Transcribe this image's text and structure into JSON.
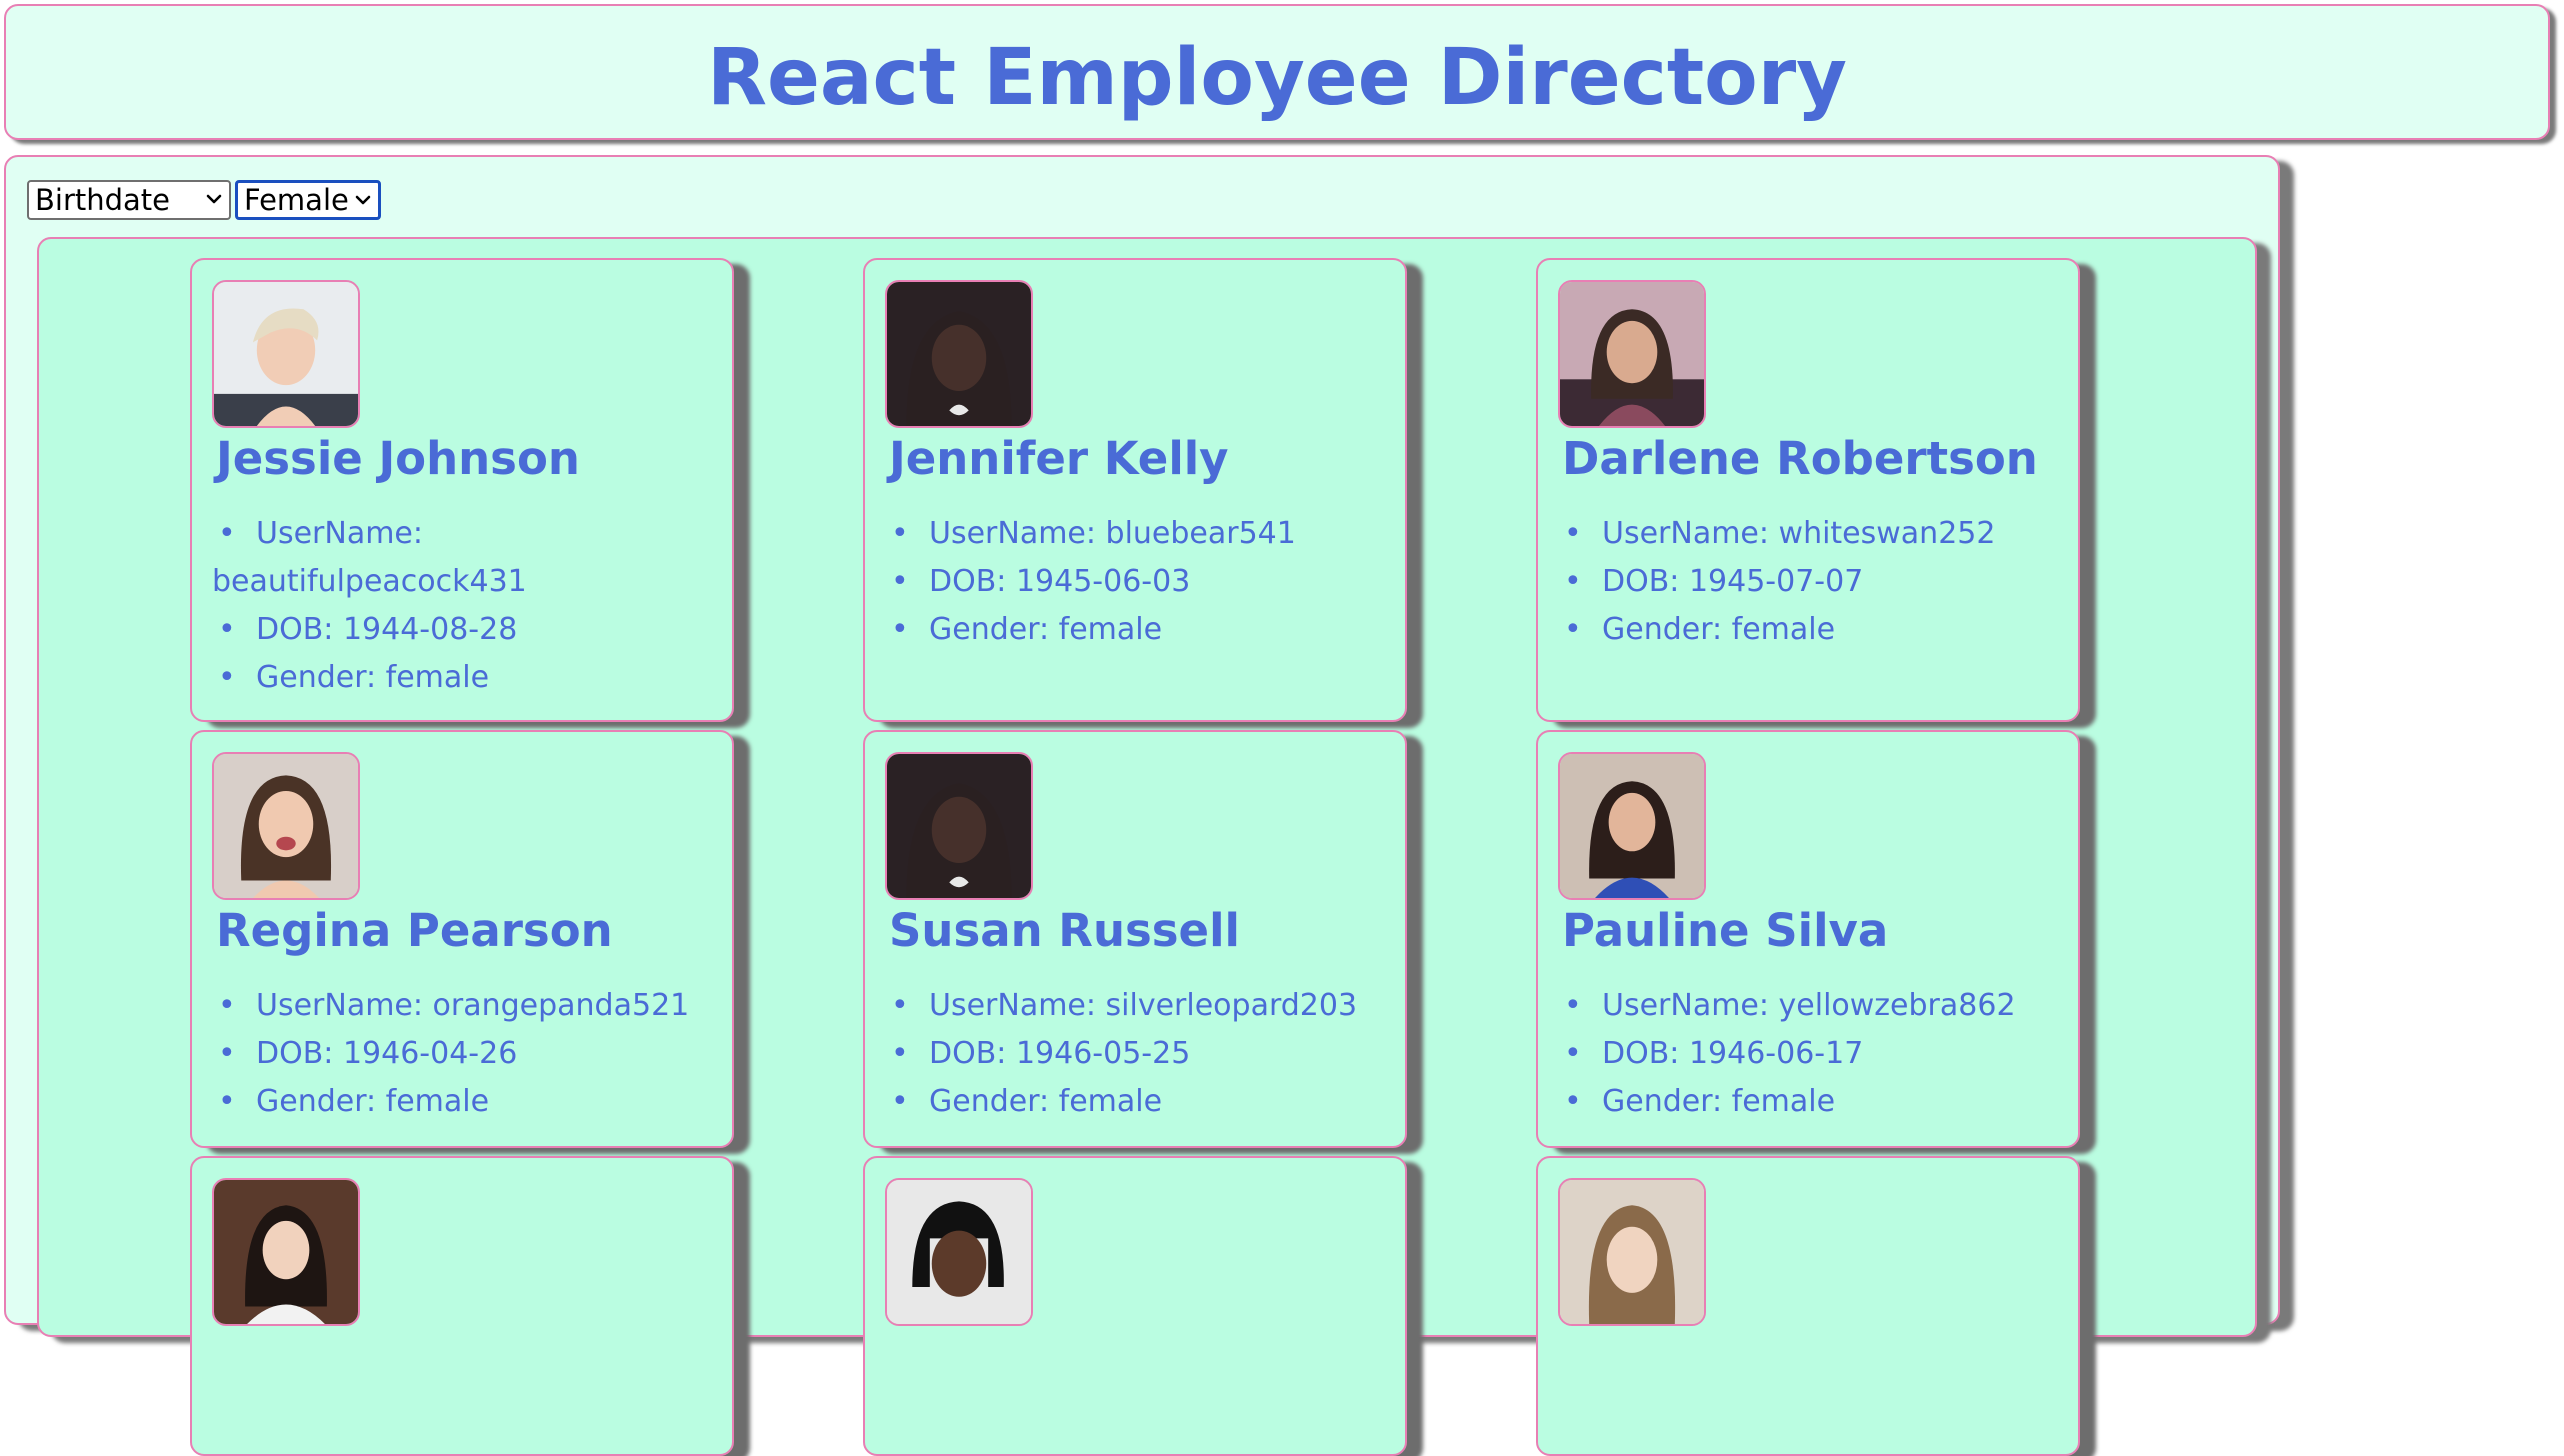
{
  "header": {
    "title": "React Employee Directory"
  },
  "controls": {
    "sort_selected": "Birthdate",
    "gender_selected": "Female"
  },
  "employees": [
    {
      "name": "Jessie Johnson",
      "username": "UserName: beautifulpeacock431",
      "dob": "DOB: 1944-08-28",
      "gender": "Gender: female"
    },
    {
      "name": "Jennifer Kelly",
      "username": "UserName: bluebear541",
      "dob": "DOB: 1945-06-03",
      "gender": "Gender: female"
    },
    {
      "name": "Darlene Robertson",
      "username": "UserName: whiteswan252",
      "dob": "DOB: 1945-07-07",
      "gender": "Gender: female"
    },
    {
      "name": "Regina Pearson",
      "username": "UserName: orangepanda521",
      "dob": "DOB: 1946-04-26",
      "gender": "Gender: female"
    },
    {
      "name": "Susan Russell",
      "username": "UserName: silverleopard203",
      "dob": "DOB: 1946-05-25",
      "gender": "Gender: female"
    },
    {
      "name": "Pauline Silva",
      "username": "UserName: yellowzebra862",
      "dob": "DOB: 1946-06-17",
      "gender": "Gender: female"
    }
  ],
  "colors": {
    "accent": "#4a6bd6",
    "border": "#e87fb4",
    "card_bg": "#bafde1",
    "panel_bg": "#e0fff3"
  }
}
